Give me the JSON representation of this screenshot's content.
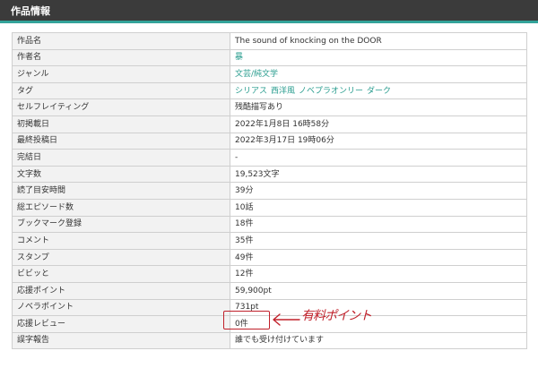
{
  "header": {
    "title": "作品情報"
  },
  "rows": [
    {
      "label": "作品名",
      "value": "The sound of knocking on the DOOR"
    },
    {
      "label": "作者名",
      "link": "暴"
    },
    {
      "label": "ジャンル",
      "link": "文芸/純文学"
    },
    {
      "label": "タグ",
      "tags": [
        "シリアス",
        "西洋風",
        "ノベプラオンリー",
        "ダーク"
      ]
    },
    {
      "label": "セルフレイティング",
      "value": "残酷描写あり"
    },
    {
      "label": "初掲載日",
      "value": "2022年1月8日 16時58分"
    },
    {
      "label": "最終投稿日",
      "value": "2022年3月17日 19時06分"
    },
    {
      "label": "完結日",
      "value": "-"
    },
    {
      "label": "文字数",
      "value": "19,523文字"
    },
    {
      "label": "読了目安時間",
      "value": "39分"
    },
    {
      "label": "総エピソード数",
      "value": "10話"
    },
    {
      "label": "ブックマーク登録",
      "value": "18件"
    },
    {
      "label": "コメント",
      "value": "35件"
    },
    {
      "label": "スタンプ",
      "value": "49件"
    },
    {
      "label": "ビビッと",
      "value": "12件"
    },
    {
      "label": "応援ポイント",
      "value": "59,900pt"
    },
    {
      "label": "ノベラポイント",
      "value": "731pt"
    },
    {
      "label": "応援レビュー",
      "value": "0件"
    },
    {
      "label": "誤字報告",
      "value": "誰でも受け付けています"
    }
  ],
  "annotation": {
    "text": "有料ポイント",
    "color": "#c0202a"
  },
  "colors": {
    "header_bg": "#3b3b3b",
    "accent": "#33a39a",
    "link": "#2a9d8f"
  }
}
